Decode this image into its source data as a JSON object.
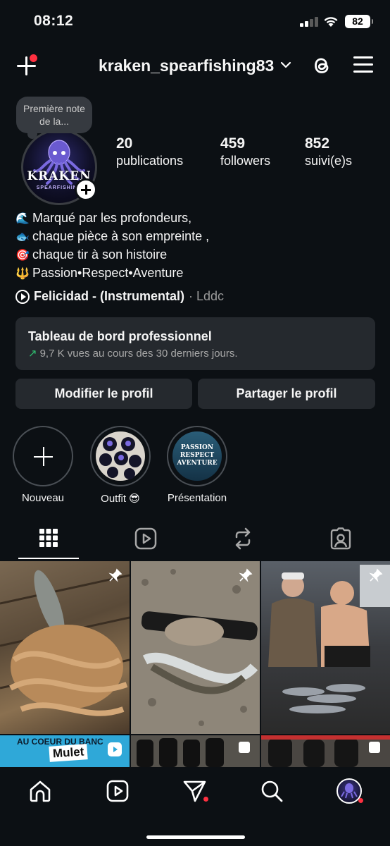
{
  "status": {
    "time": "08:12",
    "battery": "82"
  },
  "header": {
    "username": "kraken_spearfishing83"
  },
  "profile": {
    "note": "Première note de la...",
    "avatar_brand": "KRAKEN",
    "avatar_sub": "SPEARFISHING",
    "stats": [
      {
        "number": "20",
        "label": "publications"
      },
      {
        "number": "459",
        "label": "followers"
      },
      {
        "number": "852",
        "label": "suivi(e)s"
      }
    ],
    "bio": [
      {
        "emoji": "🌊",
        "text": "Marqué par les profondeurs,"
      },
      {
        "emoji": "🐟",
        "text": "chaque pièce à son empreinte ,"
      },
      {
        "emoji": "🎯",
        "text": "chaque tir à son histoire"
      },
      {
        "emoji": "🔱",
        "text": "Passion•Respect•Aventure"
      }
    ],
    "music": {
      "song": "Felicidad - (Instrumental)",
      "artist": "· Lddc"
    }
  },
  "dashboard": {
    "title": "Tableau de bord professionnel",
    "subtitle": "9,7 K vues au cours des 30 derniers jours."
  },
  "buttons": {
    "edit": "Modifier le profil",
    "share": "Partager le profil"
  },
  "highlights": [
    {
      "label": "Nouveau"
    },
    {
      "label": "Outfit 😎"
    },
    {
      "label": "Présentation",
      "cover_text": "PASSION RESPECT AVENTURE"
    }
  ],
  "grid": {
    "reel_banner_top": "AU COEUR DU BANC",
    "reel_banner_word": "Mulet"
  },
  "colors": {
    "background": "#0c1014",
    "card": "#25292e",
    "accent_red": "#ff3040",
    "trend_green": "#2fbf71"
  }
}
